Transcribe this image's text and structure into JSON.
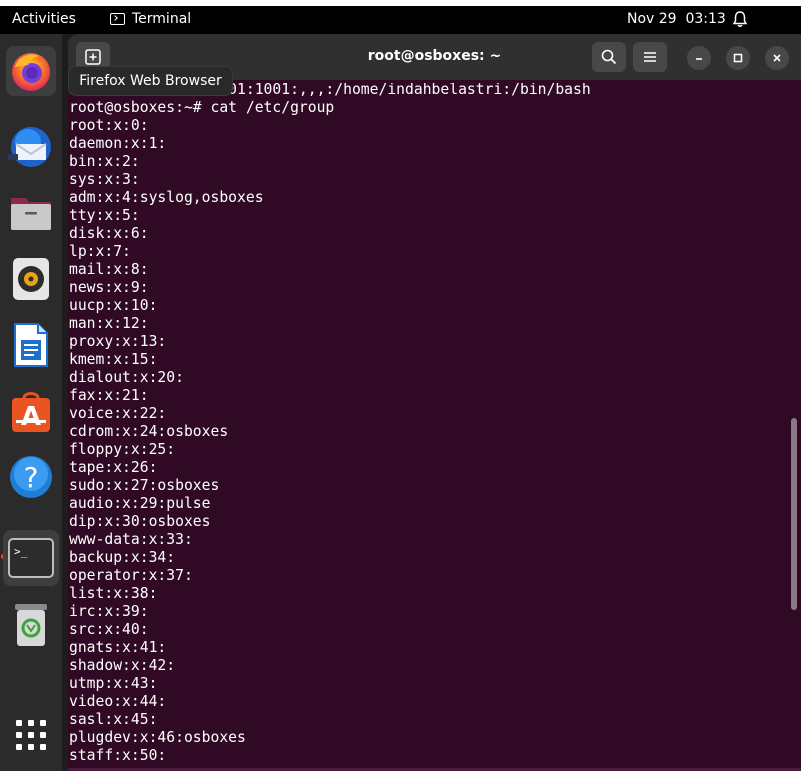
{
  "topbar": {
    "activities": "Activities",
    "app_name": "Terminal",
    "clock": "Nov 29  03:13"
  },
  "tooltip": "Firefox Web Browser",
  "window": {
    "title": "root@osboxes: ~"
  },
  "dock": {
    "items": [
      {
        "name": "Firefox Web Browser",
        "icon": "firefox-icon"
      },
      {
        "name": "Thunderbird Mail",
        "icon": "thunderbird-icon"
      },
      {
        "name": "Files",
        "icon": "files-icon"
      },
      {
        "name": "Rhythmbox",
        "icon": "rhythmbox-icon"
      },
      {
        "name": "LibreOffice Writer",
        "icon": "writer-icon"
      },
      {
        "name": "Ubuntu Software",
        "icon": "software-icon"
      },
      {
        "name": "Help",
        "icon": "help-icon"
      },
      {
        "name": "Terminal",
        "icon": "terminal-icon"
      },
      {
        "name": "Trash",
        "icon": "trash-icon"
      },
      {
        "name": "Show Applications",
        "icon": "app-grid-icon"
      }
    ]
  },
  "terminal": {
    "lines": [
      "indahbelastri:x:1001:1001:,,,:/home/indahbelastri:/bin/bash",
      "root@osboxes:~# cat /etc/group",
      "root:x:0:",
      "daemon:x:1:",
      "bin:x:2:",
      "sys:x:3:",
      "adm:x:4:syslog,osboxes",
      "tty:x:5:",
      "disk:x:6:",
      "lp:x:7:",
      "mail:x:8:",
      "news:x:9:",
      "uucp:x:10:",
      "man:x:12:",
      "proxy:x:13:",
      "kmem:x:15:",
      "dialout:x:20:",
      "fax:x:21:",
      "voice:x:22:",
      "cdrom:x:24:osboxes",
      "floppy:x:25:",
      "tape:x:26:",
      "sudo:x:27:osboxes",
      "audio:x:29:pulse",
      "dip:x:30:osboxes",
      "www-data:x:33:",
      "backup:x:34:",
      "operator:x:37:",
      "list:x:38:",
      "irc:x:39:",
      "src:x:40:",
      "gnats:x:41:",
      "shadow:x:42:",
      "utmp:x:43:",
      "video:x:44:",
      "sasl:x:45:",
      "plugdev:x:46:osboxes",
      "staff:x:50:"
    ]
  },
  "colors": {
    "terminal_bg": "#300a24",
    "accent": "#e95420"
  }
}
